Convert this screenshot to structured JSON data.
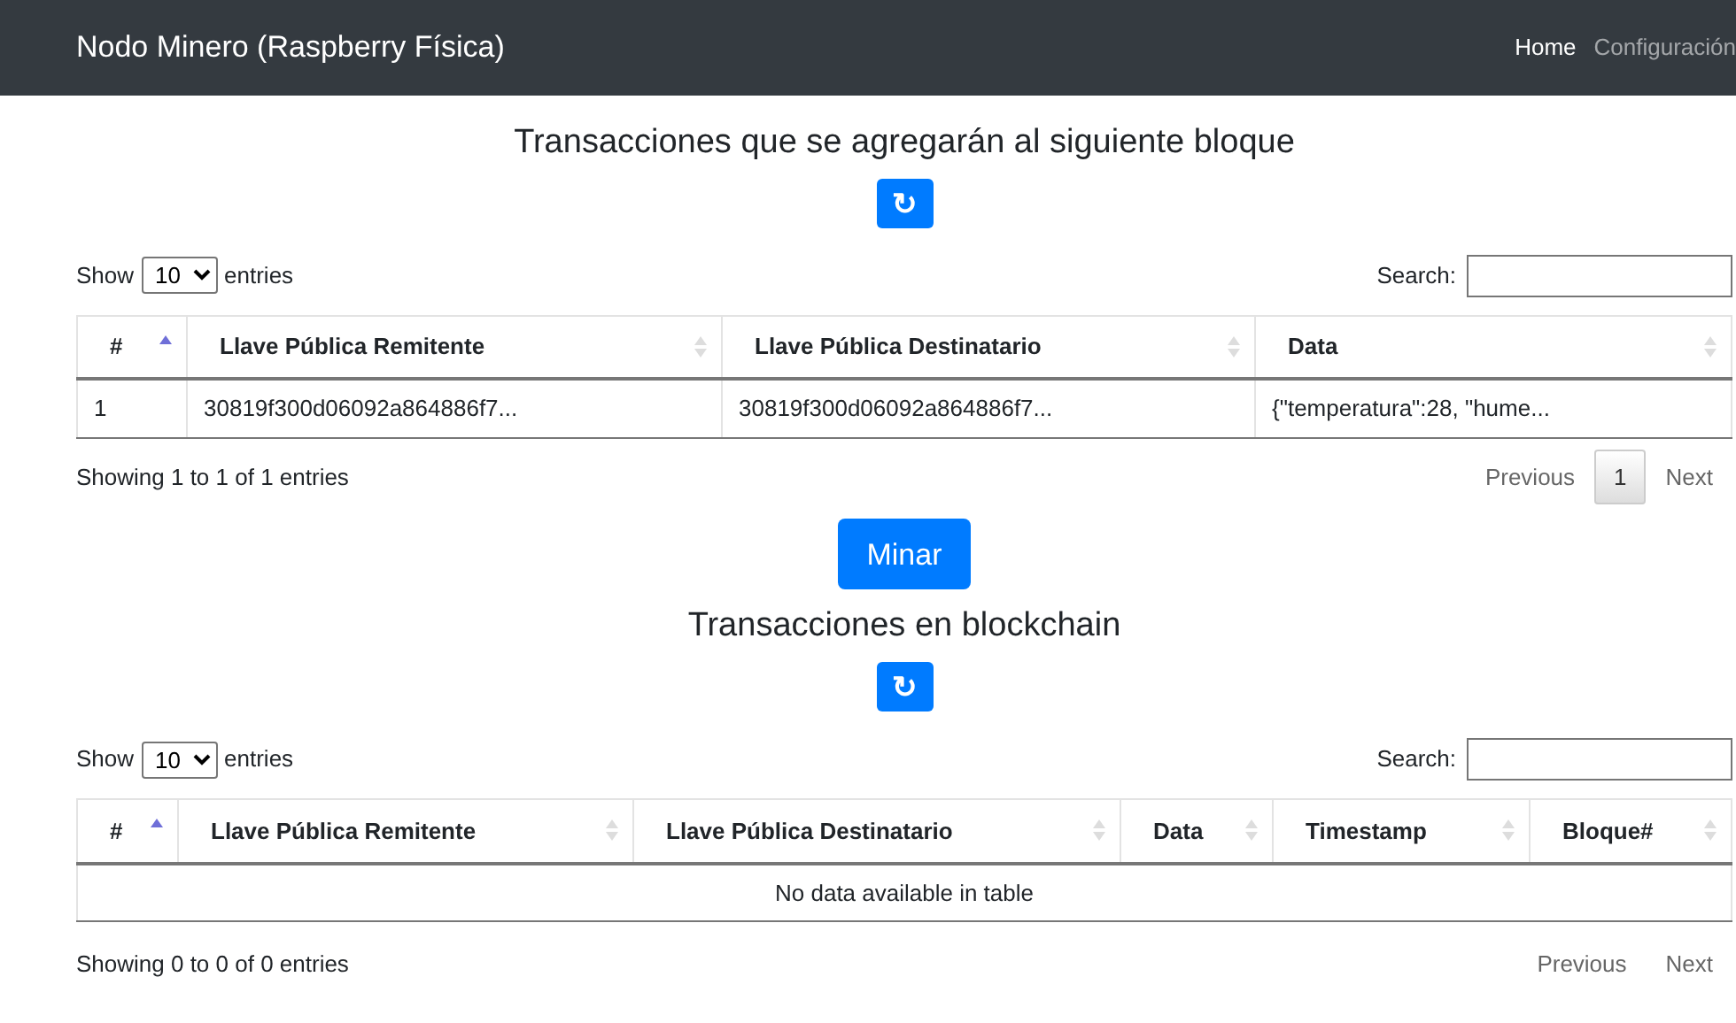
{
  "navbar": {
    "brand": "Nodo Minero (Raspberry Física)",
    "links": [
      {
        "label": "Home",
        "selected": true
      },
      {
        "label": "Configuración",
        "selected": false
      }
    ]
  },
  "sections": [
    {
      "title": "Transacciones que se agregarán al siguiente bloque",
      "refresh_icon": "↻",
      "length": {
        "show": "Show",
        "value": "10",
        "entries": "entries"
      },
      "search_label": "Search:",
      "columns": [
        {
          "label": "#",
          "sorted": true
        },
        {
          "label": "Llave Pública Remitente",
          "sorted": false
        },
        {
          "label": "Llave Pública Destinatario",
          "sorted": false
        },
        {
          "label": "Data",
          "sorted": false
        }
      ],
      "rows": [
        [
          "1",
          "30819f300d06092a864886f7...",
          "30819f300d06092a864886f7...",
          "{\"temperatura\":28, \"hume..."
        ]
      ],
      "info": "Showing 1 to 1 of 1 entries",
      "pagination": [
        {
          "label": "Previous",
          "kind": "nav"
        },
        {
          "label": "1",
          "kind": "page"
        },
        {
          "label": "Next",
          "kind": "nav"
        }
      ],
      "action_button": "Minar"
    },
    {
      "title": "Transacciones en blockchain",
      "refresh_icon": "↻",
      "length": {
        "show": "Show",
        "value": "10",
        "entries": "entries"
      },
      "search_label": "Search:",
      "columns": [
        {
          "label": "#",
          "sorted": true
        },
        {
          "label": "Llave Pública Remitente",
          "sorted": false
        },
        {
          "label": "Llave Pública Destinatario",
          "sorted": false
        },
        {
          "label": "Data",
          "sorted": false
        },
        {
          "label": "Timestamp",
          "sorted": false
        },
        {
          "label": "Bloque#",
          "sorted": false
        }
      ],
      "empty_text": "No data available in table",
      "info": "Showing 0 to 0 of 0 entries",
      "pagination": [
        {
          "label": "Previous",
          "kind": "nav"
        },
        {
          "label": "Next",
          "kind": "nav"
        }
      ]
    }
  ]
}
